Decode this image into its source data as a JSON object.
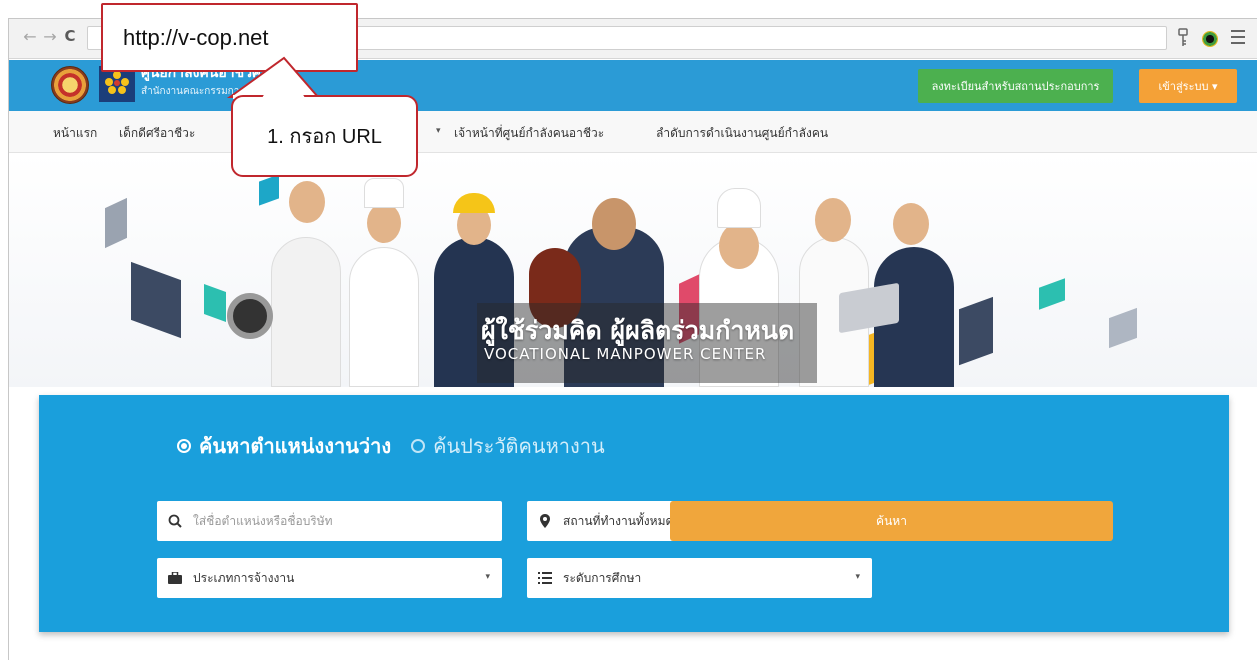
{
  "callouts": {
    "url": "http://v-cop.net",
    "step": "1. กรอก URL"
  },
  "chrome": {
    "back_icon": "←",
    "forward_icon": "→",
    "reload_icon": "C"
  },
  "header": {
    "title": "ศูนย์กำลังคนอาชีวศึกษา",
    "subtitle": "สำนักงานคณะกรรมการการอาชีวศึกษา",
    "register_button": "ลงทะเบียนสำหรับสถานประกอบการ",
    "login_button": "เข้าสู่ระบบ ▾",
    "accent": "#2b9bd6"
  },
  "menu": {
    "items": [
      "หน้าแรก",
      "เด็กดีศรีอาชีวะ",
      "เจ้าหน้าที่ศูนย์กำลังคนอาชีวะ",
      "ลำดับการดำเนินงานศูนย์กำลังคน"
    ],
    "caret": "▾"
  },
  "hero": {
    "tagline": "ผู้ใช้ร่วมคิด ผู้ผลิตร่วมกำหนด",
    "subtitle": "VOCATIONAL MANPOWER CENTER"
  },
  "search": {
    "mode_active": "ค้นหาตำแหน่งงานว่าง",
    "mode_inactive": "ค้นประวัติคนหางาน",
    "keyword_placeholder": "ใส่ชื่อตำแหน่งหรือชื่อบริษัท",
    "location_value": "สถานที่ทำงานทั้งหมด",
    "employment_value": "ประเภทการจ้างงาน",
    "education_value": "ระดับการศึกษา",
    "search_button": "ค้นหา",
    "panel_color": "#1a9fdc"
  }
}
